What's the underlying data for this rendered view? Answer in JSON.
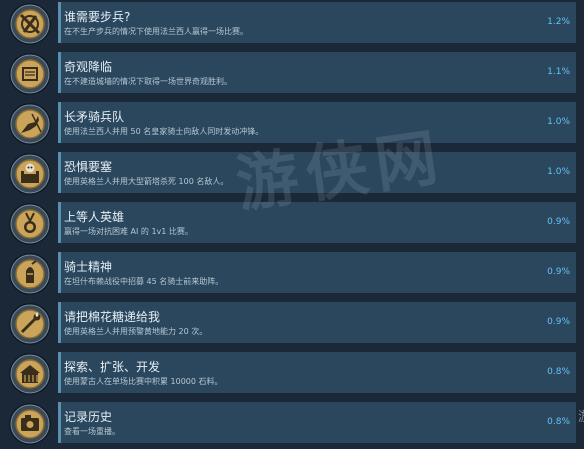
{
  "achievements": [
    {
      "title": "谁需要步兵?",
      "desc": "在不生产步兵的情况下使用法兰西人赢得一场比赛。",
      "pct": "1.2%",
      "icon": "no-infantry-icon"
    },
    {
      "title": "奇观降临",
      "desc": "在不建造城墙的情况下取得一场世界奇观胜利。",
      "pct": "1.1%",
      "icon": "wonder-icon"
    },
    {
      "title": "长矛骑兵队",
      "desc": "使用法兰西人并用 50 名皇家骑士向敌人同时发动冲锋。",
      "pct": "1.0%",
      "icon": "knight-charge-icon"
    },
    {
      "title": "恐惧要塞",
      "desc": "使用英格兰人并用大型箭塔杀死 100 名敌人。",
      "pct": "1.0%",
      "icon": "fortress-skull-icon"
    },
    {
      "title": "上等人英雄",
      "desc": "赢得一场对抗困难 AI 的 1v1 比赛。",
      "pct": "0.9%",
      "icon": "medal-icon"
    },
    {
      "title": "骑士精神",
      "desc": "在坦什布赖战役中招募 45 名骑士前来助阵。",
      "pct": "0.9%",
      "icon": "knight-helmet-icon"
    },
    {
      "title": "请把棉花糖递给我",
      "desc": "使用英格兰人并用预警黄地能力 20 次。",
      "pct": "0.9%",
      "icon": "torch-icon"
    },
    {
      "title": "探索、扩张、开发",
      "desc": "使用蒙古人在单场比赛中积累 10000 石料。",
      "pct": "0.8%",
      "icon": "building-icon"
    },
    {
      "title": "记录历史",
      "desc": "查看一场重播。",
      "pct": "0.8%",
      "icon": "camera-icon"
    }
  ],
  "watermark": "游侠网",
  "edge_char": "游",
  "colors": {
    "background": "#1b2838",
    "card": "#2a475e",
    "accent": "#67c1f5",
    "badge_gold": "#c9a45a"
  }
}
